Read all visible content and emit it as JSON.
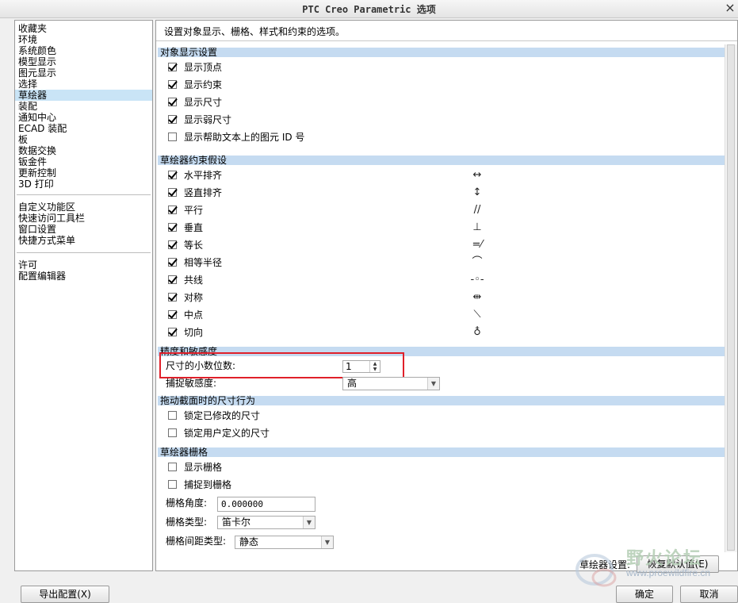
{
  "window": {
    "title": "PTC Creo Parametric 选项",
    "close": "×"
  },
  "sidebar": {
    "group1": [
      "收藏夹",
      "环境",
      "系统颜色",
      "模型显示",
      "图元显示",
      "选择",
      "草绘器",
      "装配",
      "通知中心",
      "ECAD 装配",
      "板",
      "数据交换",
      "钣金件",
      "更新控制",
      "3D 打印"
    ],
    "group2": [
      "自定义功能区",
      "快速访问工具栏",
      "窗口设置",
      "快捷方式菜单"
    ],
    "group3": [
      "许可",
      "配置编辑器"
    ],
    "selected": "草绘器"
  },
  "main": {
    "description": "设置对象显示、栅格、样式和约束的选项。",
    "object_display": {
      "header": "对象显示设置",
      "options": [
        {
          "label": "显示顶点",
          "checked": true
        },
        {
          "label": "显示约束",
          "checked": true
        },
        {
          "label": "显示尺寸",
          "checked": true
        },
        {
          "label": "显示弱尺寸",
          "checked": true
        },
        {
          "label": "显示帮助文本上的图元 ID 号",
          "checked": false
        }
      ]
    },
    "constraints": {
      "header": "草绘器约束假设",
      "options": [
        {
          "label": "水平排齐",
          "checked": true,
          "icon": "horizontal-constraint-icon",
          "glyph": "↔"
        },
        {
          "label": "竖直排齐",
          "checked": true,
          "icon": "vertical-constraint-icon",
          "glyph": "↕"
        },
        {
          "label": "平行",
          "checked": true,
          "icon": "parallel-constraint-icon",
          "glyph": "//"
        },
        {
          "label": "垂直",
          "checked": true,
          "icon": "perpendicular-constraint-icon",
          "glyph": "⊥"
        },
        {
          "label": "等长",
          "checked": true,
          "icon": "equal-length-constraint-icon",
          "glyph": "=⁄"
        },
        {
          "label": "相等半径",
          "checked": true,
          "icon": "equal-radius-constraint-icon",
          "glyph": "⌒"
        },
        {
          "label": "共线",
          "checked": true,
          "icon": "collinear-constraint-icon",
          "glyph": "-◦-"
        },
        {
          "label": "对称",
          "checked": true,
          "icon": "symmetric-constraint-icon",
          "glyph": "⇹"
        },
        {
          "label": "中点",
          "checked": true,
          "icon": "midpoint-constraint-icon",
          "glyph": "⟍"
        },
        {
          "label": "切向",
          "checked": true,
          "icon": "tangent-constraint-icon",
          "glyph": "♁"
        }
      ]
    },
    "precision": {
      "header": "精度和敏感度",
      "decimal_label": "尺寸的小数位数:",
      "decimal_value": "1",
      "snap_label": "捕捉敏感度:",
      "snap_value": "高"
    },
    "drag": {
      "header": "拖动截面时的尺寸行为",
      "options": [
        {
          "label": "锁定已修改的尺寸",
          "checked": false
        },
        {
          "label": "锁定用户定义的尺寸",
          "checked": false
        }
      ]
    },
    "grid": {
      "header": "草绘器栅格",
      "options": [
        {
          "label": "显示栅格",
          "checked": false
        },
        {
          "label": "捕捉到栅格",
          "checked": false
        }
      ],
      "angle_label": "栅格角度:",
      "angle_value": "0.000000",
      "type_label": "栅格类型:",
      "type_value": "笛卡尔",
      "spacing_label": "栅格间距类型:",
      "spacing_value": "静态"
    }
  },
  "footer": {
    "sketcher_settings_label": "草绘器设置:",
    "restore_defaults": "恢复默认值(E)",
    "export_config": "导出配置(X)",
    "ok": "确定",
    "cancel": "取消"
  },
  "watermark": {
    "text": "野火论坛",
    "url": "www.proewildfire.cn"
  }
}
